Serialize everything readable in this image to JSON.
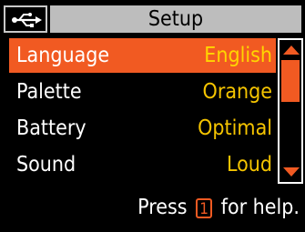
{
  "header": {
    "title": "Setup",
    "usb_icon": "usb-icon"
  },
  "menu": {
    "items": [
      {
        "label": "Language",
        "value": "English",
        "selected": true
      },
      {
        "label": "Palette",
        "value": "Orange",
        "selected": false
      },
      {
        "label": "Battery",
        "value": "Optimal",
        "selected": false
      },
      {
        "label": "Sound",
        "value": "Loud",
        "selected": false
      }
    ]
  },
  "help": {
    "before": "Press",
    "key": "1",
    "after": "for help."
  },
  "colors": {
    "accent": "#f15a22",
    "value_text": "#f5c400",
    "title_bar": "#bdbdbd",
    "background": "#000000"
  }
}
